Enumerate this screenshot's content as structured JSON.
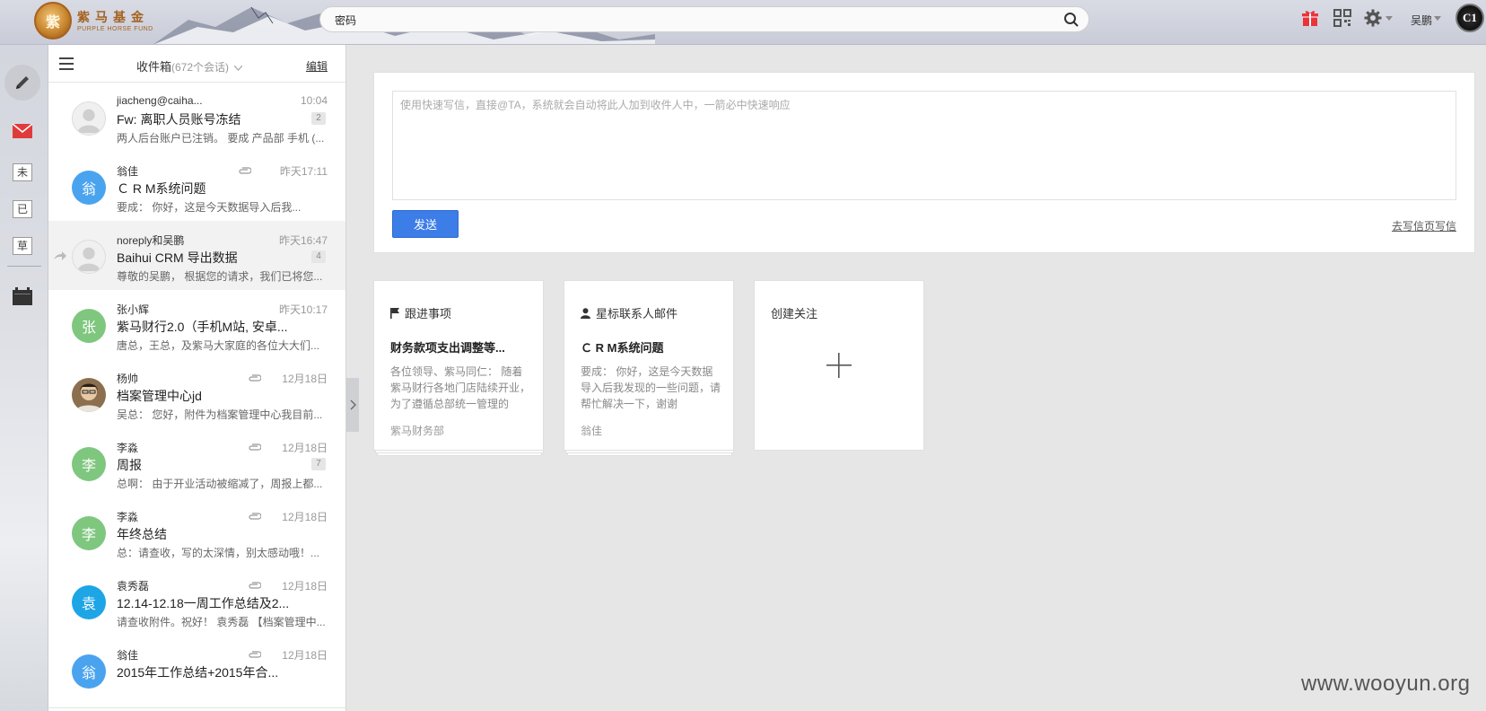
{
  "header": {
    "logo_glyph": "紫",
    "logo_cn": "紫马基金",
    "logo_en": "PURPLE HORSE FUND",
    "search_value": "密码",
    "user_name": "吴鹏",
    "avatar_text": "C1"
  },
  "rail": {
    "unread": "未",
    "read": "已",
    "draft": "草"
  },
  "inbox": {
    "title": "收件箱",
    "count": "(672个会话)",
    "edit": "编辑",
    "rows": [
      {
        "sender": "jiacheng@caiha...",
        "time": "10:04",
        "subject": "Fw: 离职人员账号冻结",
        "preview": "两人后台账户已注销。 要成 产品部 手机 (...",
        "badge": "2",
        "avatar": "",
        "avatar_color": "default",
        "clip": false
      },
      {
        "sender": "翁佳",
        "time": "昨天17:11",
        "subject": "Ｃ R M系统问题",
        "preview": "要成：      你好，这是今天数据导入后我...",
        "badge": "",
        "avatar": "翁",
        "avatar_color": "#4aa3ef",
        "clip": true
      },
      {
        "sender": "noreply和吴鹏",
        "time": "昨天16:47",
        "subject": "Baihui CRM 导出数据",
        "preview": "尊敬的吴鹏， 根据您的请求，我们已将您...",
        "badge": "4",
        "avatar": "",
        "avatar_color": "default",
        "clip": false
      },
      {
        "sender": "张小辉",
        "time": "昨天10:17",
        "subject": "紫马财行2.0（手机M站, 安卓...",
        "preview": "唐总，王总，及紫马大家庭的各位大大们...",
        "badge": "",
        "avatar": "张",
        "avatar_color": "#7fc77f",
        "clip": false
      },
      {
        "sender": "杨帅",
        "time": "12月18日",
        "subject": "档案管理中心jd",
        "preview": "吴总： 您好，附件为档案管理中心我目前...",
        "badge": "",
        "avatar": "",
        "avatar_color": "photo",
        "clip": true
      },
      {
        "sender": "李淼",
        "time": "12月18日",
        "subject": "周报",
        "preview": "总啊： 由于开业活动被缩减了，周报上都...",
        "badge": "7",
        "avatar": "李",
        "avatar_color": "#7fc77f",
        "clip": true
      },
      {
        "sender": "李淼",
        "time": "12月18日",
        "subject": "年终总结",
        "preview": "总：请查收，写的太深情，别太感动哦！...",
        "badge": "",
        "avatar": "李",
        "avatar_color": "#7fc77f",
        "clip": true
      },
      {
        "sender": "袁秀磊",
        "time": "12月18日",
        "subject": "12.14-12.18一周工作总结及2...",
        "preview": "请查收附件。祝好！ 袁秀磊 【档案管理中...",
        "badge": "",
        "avatar": "袁",
        "avatar_color": "#1ea5e6",
        "clip": true
      },
      {
        "sender": "翁佳",
        "time": "12月18日",
        "subject": "2015年工作总结+2015年合...",
        "preview": "",
        "badge": "",
        "avatar": "翁",
        "avatar_color": "#4aa3ef",
        "clip": true
      }
    ]
  },
  "quick": {
    "placeholder": "使用快速写信，直接@TA，系统就会自动将此人加到收件人中，一箭必中快速响应",
    "send": "发送",
    "full_write": "去写信页写信"
  },
  "tiles": [
    {
      "head": "跟进事项",
      "icon": "flag-icon",
      "title": "财务款项支出调整等...",
      "body": "各位领导、紫马同仁： 随着紫马财行各地门店陆续开业，为了遵循总部统一管理的",
      "foot": "紫马财务部"
    },
    {
      "head": "星标联系人邮件",
      "icon": "person-icon",
      "title": "Ｃ R M系统问题",
      "body": "要成：      你好，这是今天数据导入后我发现的一些问题，请帮忙解决一下，谢谢",
      "foot": "翁佳"
    },
    {
      "head": "创建关注",
      "icon": "plus-icon",
      "title": "",
      "body": "",
      "foot": ""
    }
  ],
  "watermark": "www.wooyun.org",
  "colors": {
    "accent": "#3c7de8",
    "mail_red": "#e03b3b",
    "gift_red": "#e8343a"
  }
}
